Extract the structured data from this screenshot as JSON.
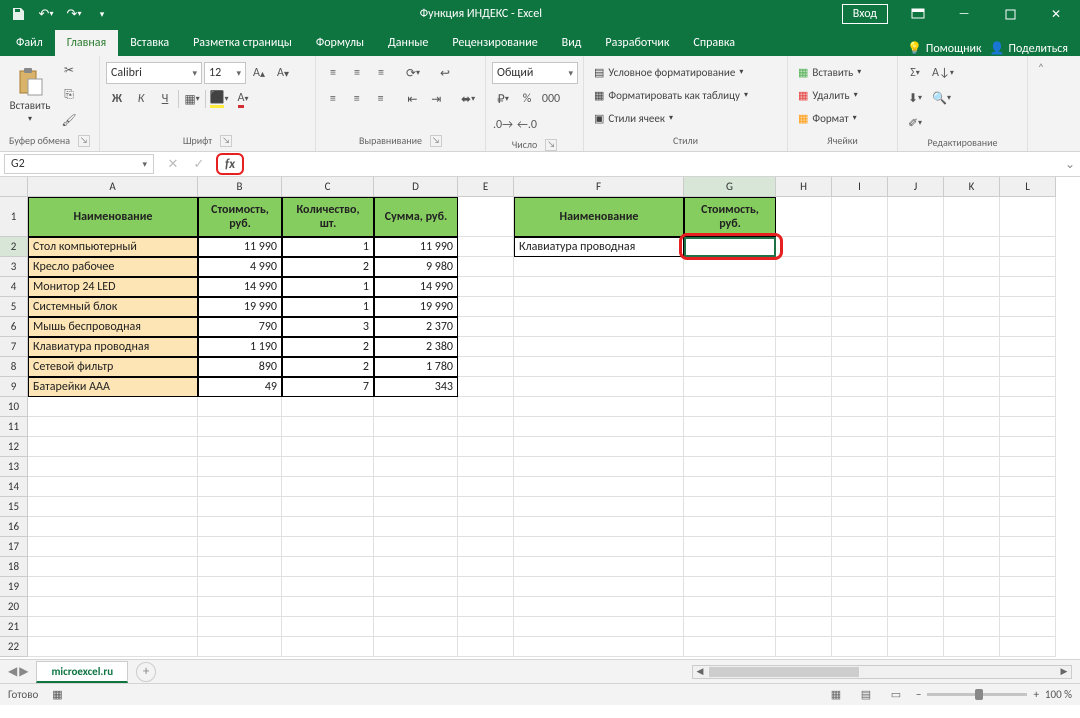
{
  "title": "Функция ИНДЕКС  -  Excel",
  "login": "Вход",
  "tabs": {
    "file": "Файл",
    "home": "Главная",
    "insert": "Вставка",
    "layout": "Разметка страницы",
    "formulas": "Формулы",
    "data": "Данные",
    "review": "Рецензирование",
    "view": "Вид",
    "developer": "Разработчик",
    "help": "Справка",
    "tellme": "Помощник",
    "share": "Поделиться"
  },
  "ribbon": {
    "clipboard": {
      "paste": "Вставить",
      "label": "Буфер обмена"
    },
    "font": {
      "name": "Calibri",
      "size": "12",
      "label": "Шрифт",
      "bold": "Ж",
      "italic": "К",
      "underline": "Ч"
    },
    "align": {
      "label": "Выравнивание"
    },
    "number": {
      "format": "Общий",
      "label": "Число"
    },
    "styles": {
      "cond": "Условное форматирование",
      "table": "Форматировать как таблицу",
      "cell": "Стили ячеек",
      "label": "Стили"
    },
    "cells": {
      "insert": "Вставить",
      "delete": "Удалить",
      "format": "Формат",
      "label": "Ячейки"
    },
    "editing": {
      "label": "Редактирование"
    }
  },
  "namebox": "G2",
  "formula": "",
  "cols": [
    "A",
    "B",
    "C",
    "D",
    "E",
    "F",
    "G",
    "H",
    "I",
    "J",
    "K",
    "L"
  ],
  "colw": {
    "A": 170,
    "B": 84,
    "C": 92,
    "D": 84,
    "E": 56,
    "F": 170,
    "G": 92,
    "H": 56,
    "I": 56,
    "J": 56,
    "K": 56,
    "L": 56
  },
  "rows": [
    1,
    2,
    3,
    4,
    5,
    6,
    7,
    8,
    9,
    10,
    11,
    12,
    13,
    14,
    15,
    16,
    17,
    18,
    19,
    20,
    21,
    22
  ],
  "table1": {
    "headers": [
      "Наименование",
      "Стоимость, руб.",
      "Количество, шт.",
      "Сумма, руб."
    ],
    "rows": [
      [
        "Стол компьютерный",
        "11 990",
        "1",
        "11 990"
      ],
      [
        "Кресло рабочее",
        "4 990",
        "2",
        "9 980"
      ],
      [
        "Монитор 24 LED",
        "14 990",
        "1",
        "14 990"
      ],
      [
        "Системный блок",
        "19 990",
        "1",
        "19 990"
      ],
      [
        "Мышь беспроводная",
        "790",
        "3",
        "2 370"
      ],
      [
        "Клавиатура проводная",
        "1 190",
        "2",
        "2 380"
      ],
      [
        "Сетевой фильтр",
        "890",
        "2",
        "1 780"
      ],
      [
        "Батарейки AAA",
        "49",
        "7",
        "343"
      ]
    ]
  },
  "table2": {
    "headers": [
      "Наименование",
      "Стоимость, руб."
    ],
    "rows": [
      [
        "Клавиатура проводная",
        ""
      ]
    ]
  },
  "sheet": "microexcel.ru",
  "status": "Готово",
  "zoom": "100 %"
}
